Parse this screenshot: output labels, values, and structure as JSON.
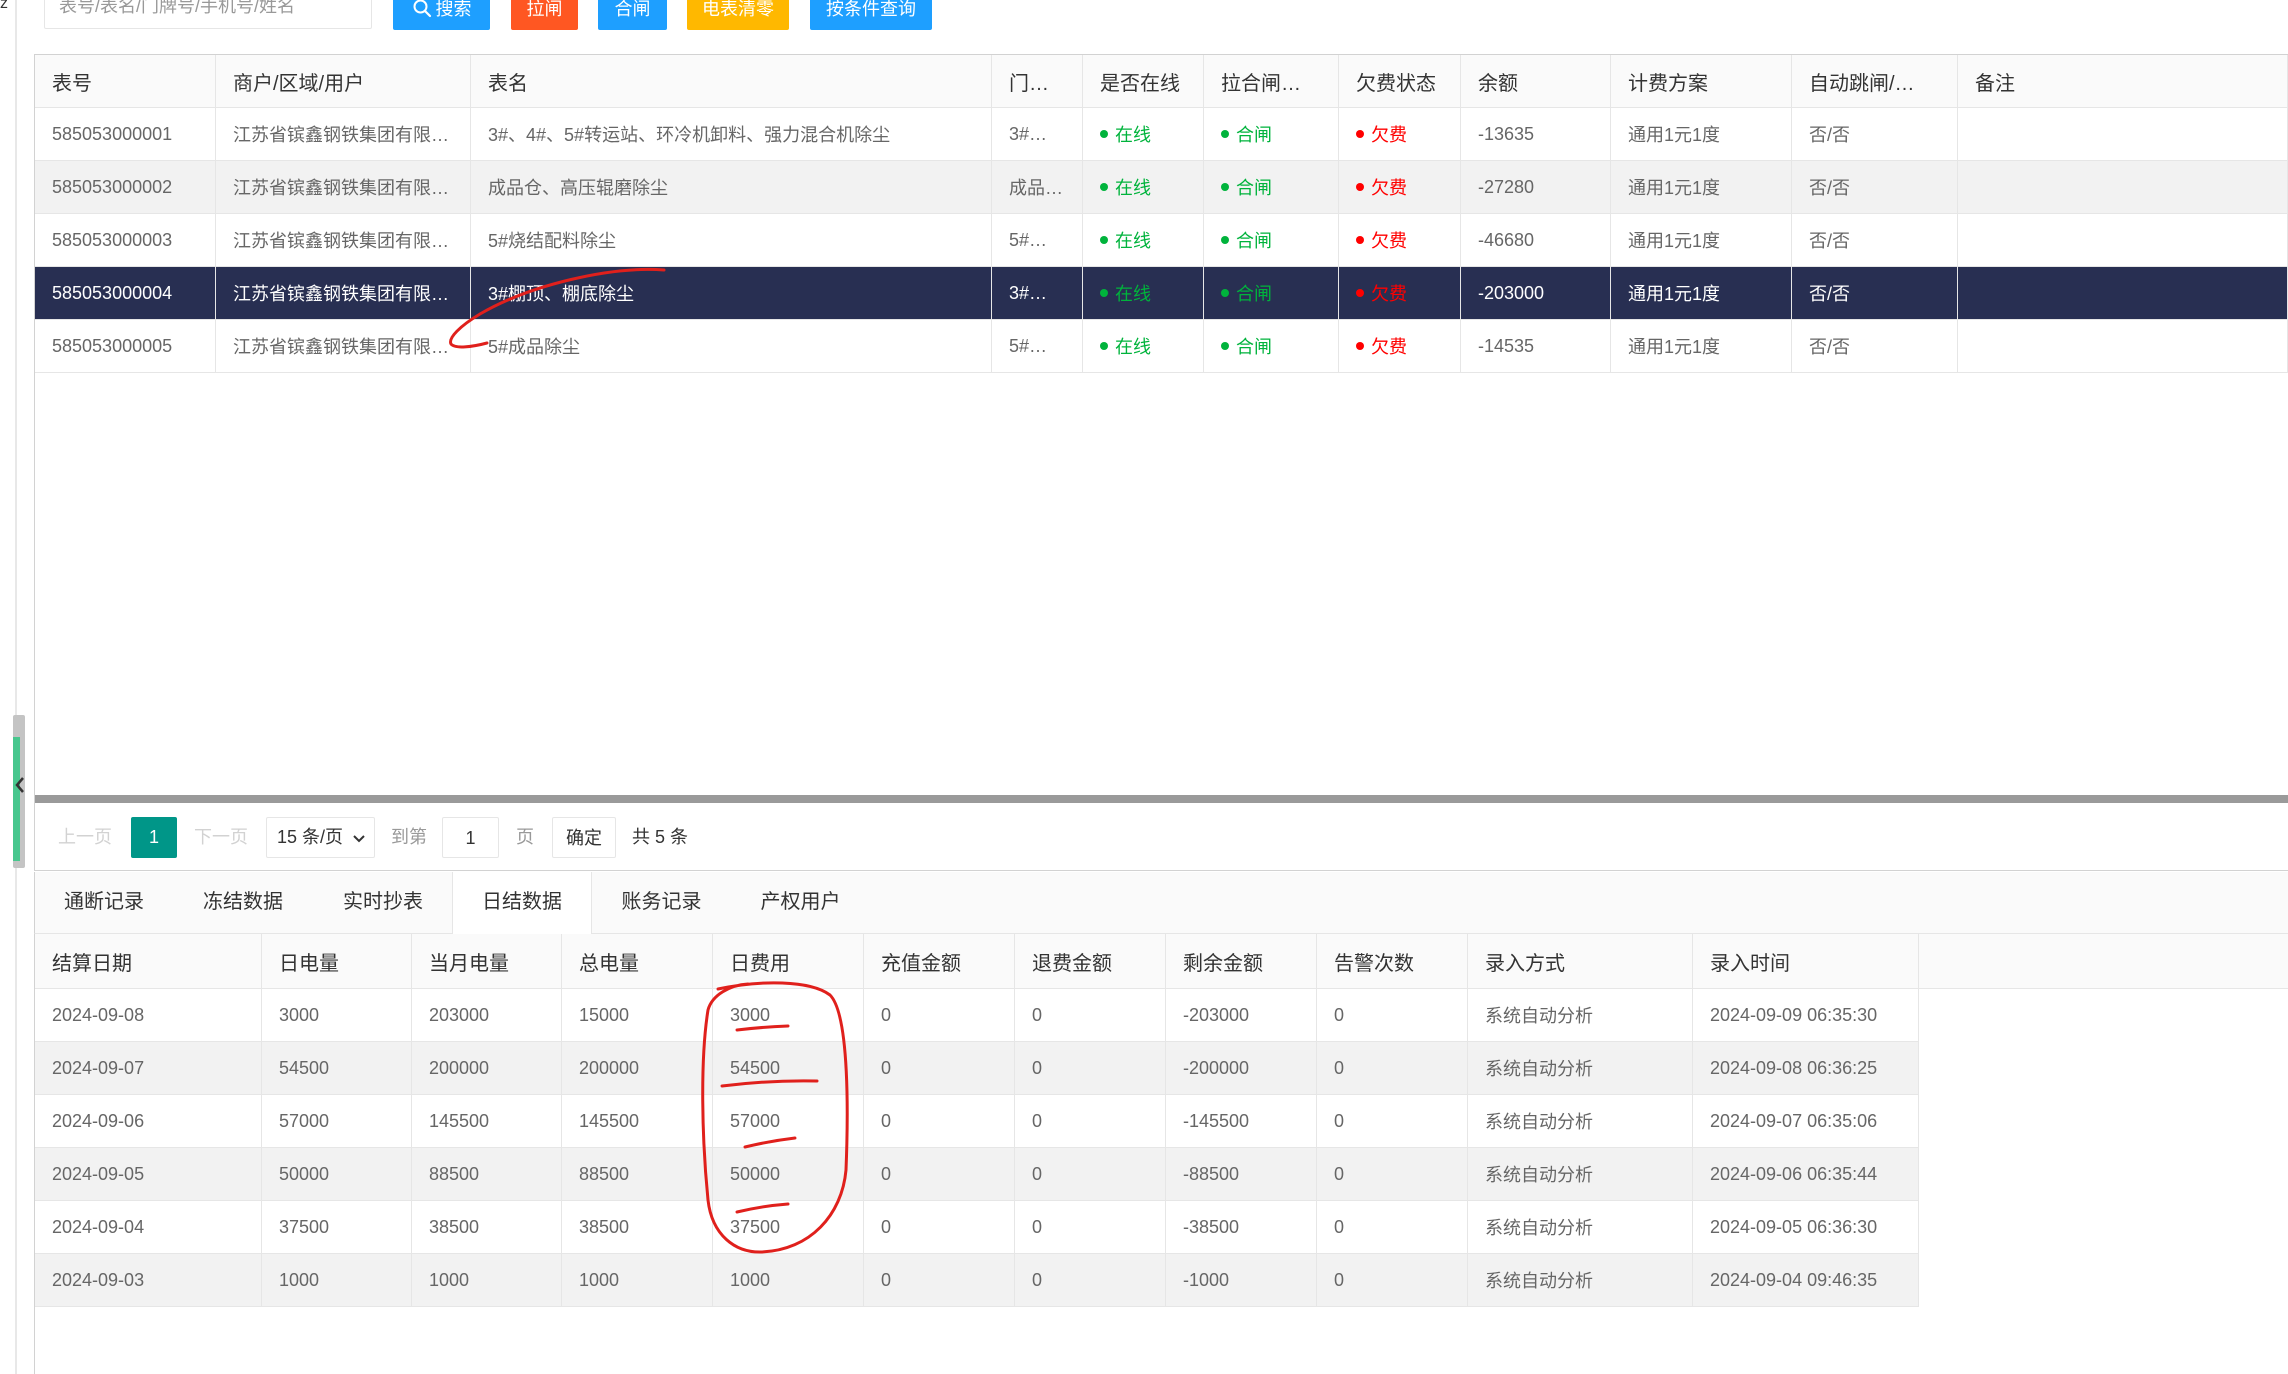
{
  "corner_text": "z",
  "colors": {
    "primary": "#1e9fff",
    "danger": "#ff5722",
    "warm": "#ffb800",
    "teal": "#009688",
    "selected_row": "#282f52",
    "online_green": "#00b33c",
    "arrears_red": "#ff0000",
    "annotation_red": "#e0201c"
  },
  "icons": {
    "search": "search-icon",
    "page_size_dropdown": "chevron-down-icon",
    "sidebar_toggle": "chevron-left-icon",
    "status_dot": "status-dot-icon"
  },
  "toolbar": {
    "search_placeholder": "表号/表名/门牌号/手机号/姓名",
    "buttons": {
      "search": "搜索",
      "switch_off": "拉闸",
      "switch_on": "合闸",
      "meter_reset": "电表清零",
      "condition_query": "按条件查询"
    }
  },
  "main_table": {
    "headers": [
      "表号",
      "商户/区域/用户",
      "表名",
      "门…",
      "是否在线",
      "拉合闸…",
      "欠费状态",
      "余额",
      "计费方案",
      "自动跳闸/…",
      "备注"
    ],
    "selected_row_index": 3,
    "rows": [
      [
        "585053000001",
        "江苏省镔鑫钢铁集团有限…",
        "3#、4#、5#转运站、环冷机卸料、强力混合机除尘",
        "3#…",
        "在线",
        "合闸",
        "欠费",
        "-13635",
        "通用1元1度",
        "否/否"
      ],
      [
        "585053000002",
        "江苏省镔鑫钢铁集团有限…",
        "成品仓、高压辊磨除尘",
        "成品…",
        "在线",
        "合闸",
        "欠费",
        "-27280",
        "通用1元1度",
        "否/否"
      ],
      [
        "585053000003",
        "江苏省镔鑫钢铁集团有限…",
        "5#烧结配料除尘",
        "5#…",
        "在线",
        "合闸",
        "欠费",
        "-46680",
        "通用1元1度",
        "否/否"
      ],
      [
        "585053000004",
        "江苏省镔鑫钢铁集团有限…",
        "3#棚顶、棚底除尘",
        "3#…",
        "在线",
        "合闸",
        "欠费",
        "-203000",
        "通用1元1度",
        "否/否"
      ],
      [
        "585053000005",
        "江苏省镔鑫钢铁集团有限…",
        "5#成品除尘",
        "5#…",
        "在线",
        "合闸",
        "欠费",
        "-14535",
        "通用1元1度",
        "否/否"
      ]
    ]
  },
  "pagination": {
    "prev": "上一页",
    "current_page": "1",
    "next": "下一页",
    "page_size": "15 条/页",
    "goto_label": "到第",
    "goto_value": "1",
    "page_unit": "页",
    "confirm": "确定",
    "total": "共 5 条"
  },
  "tabs": {
    "active_index": 3,
    "items": [
      "通断记录",
      "冻结数据",
      "实时抄表",
      "日结数据",
      "账务记录",
      "产权用户"
    ]
  },
  "daily_table": {
    "headers": [
      "结算日期",
      "日电量",
      "当月电量",
      "总电量",
      "日费用",
      "充值金额",
      "退费金额",
      "剩余金额",
      "告警次数",
      "录入方式",
      "录入时间"
    ],
    "rows": [
      [
        "2024-09-08",
        "3000",
        "203000",
        "15000",
        "3000",
        "0",
        "0",
        "-203000",
        "0",
        "系统自动分析",
        "2024-09-09 06:35:30"
      ],
      [
        "2024-09-07",
        "54500",
        "200000",
        "200000",
        "54500",
        "0",
        "0",
        "-200000",
        "0",
        "系统自动分析",
        "2024-09-08 06:36:25"
      ],
      [
        "2024-09-06",
        "57000",
        "145500",
        "145500",
        "57000",
        "0",
        "0",
        "-145500",
        "0",
        "系统自动分析",
        "2024-09-07 06:35:06"
      ],
      [
        "2024-09-05",
        "50000",
        "88500",
        "88500",
        "50000",
        "0",
        "0",
        "-88500",
        "0",
        "系统自动分析",
        "2024-09-06 06:35:44"
      ],
      [
        "2024-09-04",
        "37500",
        "38500",
        "38500",
        "37500",
        "0",
        "0",
        "-38500",
        "0",
        "系统自动分析",
        "2024-09-05 06:36:30"
      ],
      [
        "2024-09-03",
        "1000",
        "1000",
        "1000",
        "1000",
        "0",
        "0",
        "-1000",
        "0",
        "系统自动分析",
        "2024-09-04 09:46:35"
      ]
    ]
  }
}
